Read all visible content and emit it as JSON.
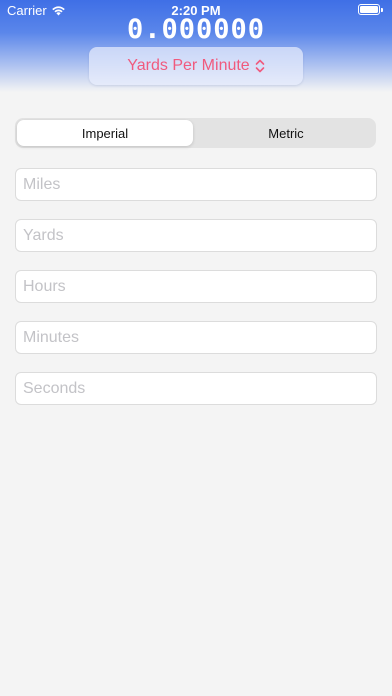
{
  "status_bar": {
    "carrier": "Carrier",
    "time": "2:20 PM",
    "wifi_icon": "wifi-icon",
    "battery_icon": "battery-icon"
  },
  "header": {
    "result": "0.000000",
    "unit_selector": {
      "label": "Yards Per Minute",
      "icon": "chevron-updown-icon",
      "color": "#f05a7e"
    },
    "gradient_color": "#3f6fe6"
  },
  "unit_system": {
    "options": [
      "Imperial",
      "Metric"
    ],
    "selected": "Imperial"
  },
  "fields": [
    {
      "placeholder": "Miles",
      "value": ""
    },
    {
      "placeholder": "Yards",
      "value": ""
    },
    {
      "placeholder": "Hours",
      "value": ""
    },
    {
      "placeholder": "Minutes",
      "value": ""
    },
    {
      "placeholder": "Seconds",
      "value": ""
    }
  ]
}
